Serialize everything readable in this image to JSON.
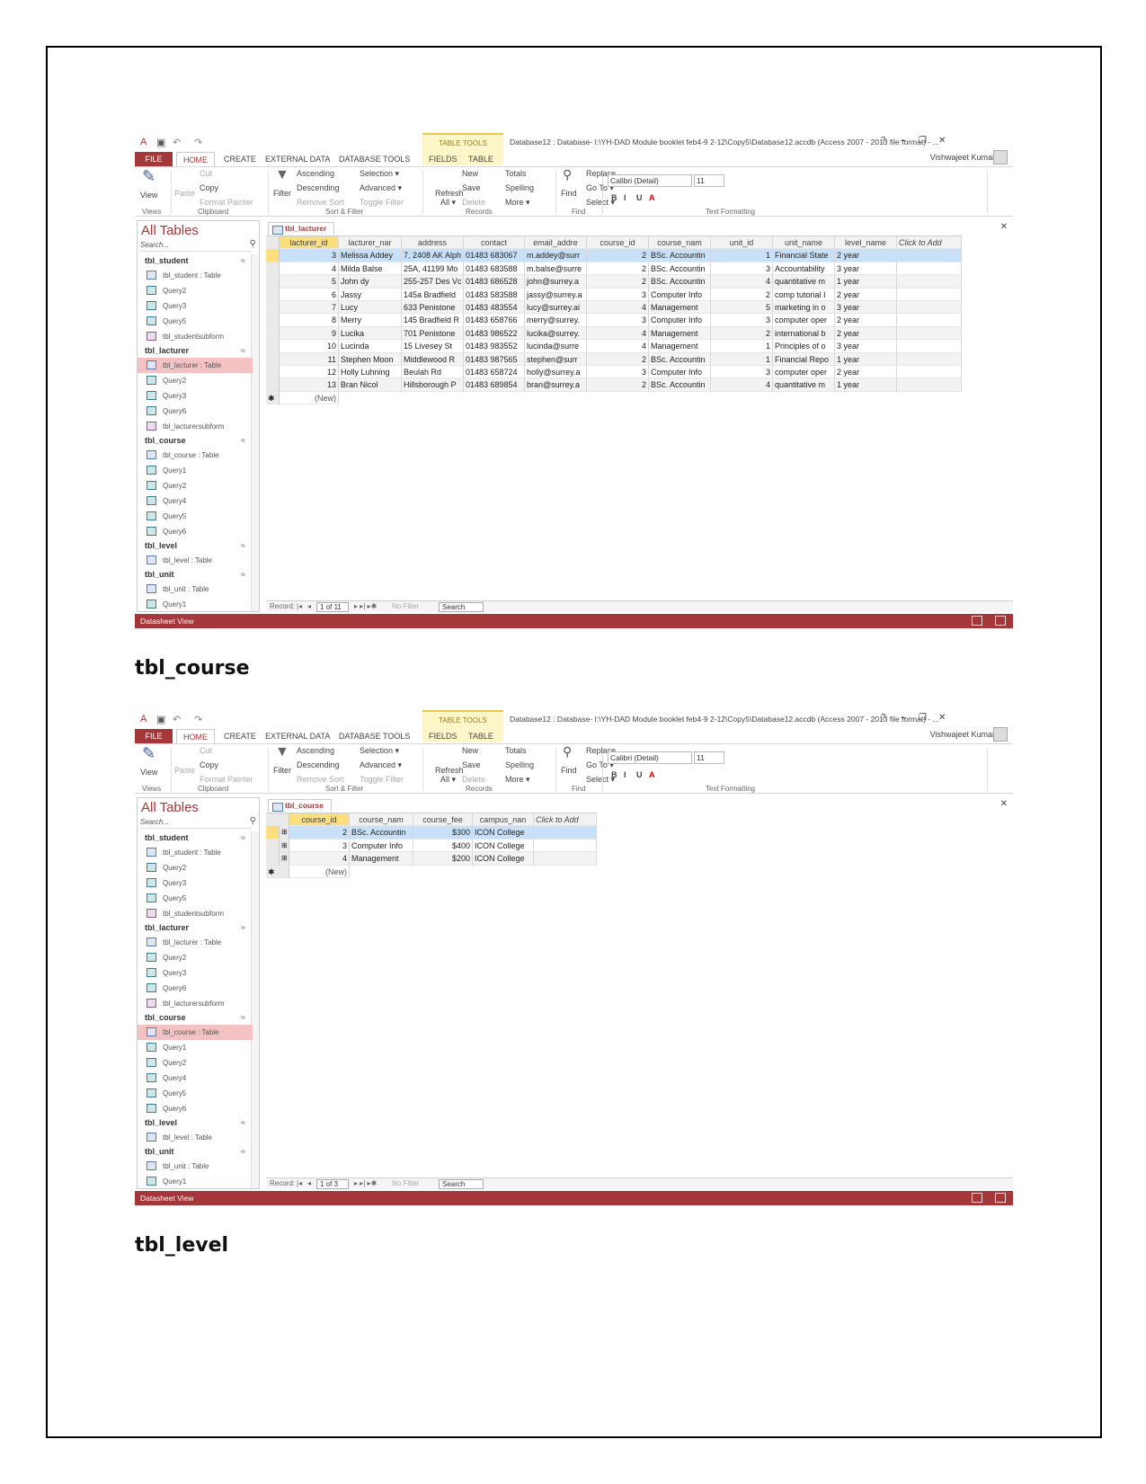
{
  "document": {
    "headings": [
      "tbl_course",
      "tbl_level"
    ]
  },
  "access": {
    "title": "Database12 : Database- I:\\YH-DAD Module booklet feb4-9 2-12\\Copy5\\Database12.accdb (Access 2007 - 2013 file format) - ...",
    "table_tools": "TABLE TOOLS",
    "tabs": [
      "FILE",
      "HOME",
      "CREATE",
      "EXTERNAL DATA",
      "DATABASE TOOLS",
      "FIELDS",
      "TABLE"
    ],
    "user": "Vishwajeet Kumar",
    "window_controls": [
      "?",
      "–",
      "❐",
      "✕"
    ],
    "ribbon": {
      "view": "View",
      "paste": "Paste",
      "cut": "Cut",
      "copy": "Copy",
      "format_painter": "Format Painter",
      "filter": "Filter",
      "ascending": "Ascending",
      "descending": "Descending",
      "remove_sort": "Remove Sort",
      "selection": "Selection ▾",
      "advanced": "Advanced ▾",
      "toggle_filter": "Toggle Filter",
      "refresh": "Refresh",
      "refresh_all": "All ▾",
      "new": "New",
      "save": "Save",
      "delete": "Delete",
      "totals": "Totals",
      "spelling": "Spelling",
      "more": "More ▾",
      "find": "Find",
      "replace": "Replace",
      "go_to": "Go To ▾",
      "select": "Select ▾",
      "font": "Calibri (Detail)",
      "font_size": "11",
      "groups": [
        "Views",
        "Clipboard",
        "Sort & Filter",
        "Records",
        "Find",
        "Text Formatting"
      ]
    },
    "nav": {
      "header": "All Tables",
      "search_placeholder": "Search...",
      "groups": [
        {
          "name": "tbl_student",
          "items": [
            [
              "tbl_student : Table",
              "t"
            ],
            [
              "Query2",
              "q"
            ],
            [
              "Query3",
              "q"
            ],
            [
              "Query5",
              "q"
            ],
            [
              "tbl_studentsubform",
              "f"
            ]
          ]
        },
        {
          "name": "tbl_lacturer",
          "items": [
            [
              "tbl_lacturer : Table",
              "t"
            ],
            [
              "Query2",
              "q"
            ],
            [
              "Query3",
              "q"
            ],
            [
              "Query6",
              "q"
            ],
            [
              "tbl_lacturersubform",
              "f"
            ]
          ]
        },
        {
          "name": "tbl_course",
          "items": [
            [
              "tbl_course : Table",
              "t"
            ],
            [
              "Query1",
              "q"
            ],
            [
              "Query2",
              "q"
            ],
            [
              "Query4",
              "q"
            ],
            [
              "Query5",
              "q"
            ],
            [
              "Query6",
              "q"
            ]
          ]
        },
        {
          "name": "tbl_level",
          "items": [
            [
              "tbl_level : Table",
              "t"
            ]
          ]
        },
        {
          "name": "tbl_unit",
          "items": [
            [
              "tbl_unit : Table",
              "t"
            ],
            [
              "Query1",
              "q"
            ]
          ]
        }
      ]
    },
    "status_text": "Datasheet View",
    "record_label": "Record:",
    "no_filter": "No Filter",
    "search": "Search",
    "new_row": "(New)",
    "colors": {
      "accent": "#a4373a",
      "selected_row": "#c8e1f9",
      "active_header": "#fbdf7f",
      "nav_selected": "#f4c2c3"
    }
  },
  "screens": [
    {
      "tab": "tbl_lacturer",
      "selected_nav": "tbl_lacturer : Table",
      "record": "1 of 11",
      "columns": [
        "lacturer_id",
        "lacturer_nar",
        "address",
        "contact",
        "email_addre",
        "course_id",
        "course_nam",
        "unit_id",
        "unit_name",
        "level_name",
        "Click to Add"
      ],
      "rows": [
        [
          "3",
          "Melissa Addey",
          "7, 2408 AK Alph",
          "01483 683067",
          "m.addey@surr",
          "2",
          "BSc. Accountin",
          "1",
          "Financial State",
          "2 year"
        ],
        [
          "4",
          "Milda Balse",
          "25A, 41199 Mo",
          "01483 683588",
          "m.balse@surre",
          "2",
          "BSc. Accountin",
          "3",
          "Accountability",
          "3 year"
        ],
        [
          "5",
          "John dy",
          "255-257 Des Vc",
          "01483 686528",
          "john@surrey.a",
          "2",
          "BSc. Accountin",
          "4",
          "quantitative m",
          "1 year"
        ],
        [
          "6",
          "Jassy",
          "145a Bradfield",
          "01483 583588",
          "jassy@surrey.a",
          "3",
          "Computer Info",
          "2",
          "comp tutorial I",
          "2 year"
        ],
        [
          "7",
          "Lucy",
          "633 Penistone",
          "01483 483554",
          "lucy@surrey.ai",
          "4",
          "Management",
          "5",
          "marketing in o",
          "3 year"
        ],
        [
          "8",
          "Merry",
          "145 Bradfield R",
          "01483 658766",
          "merry@surrey.",
          "3",
          "Computer Info",
          "3",
          "computer oper",
          "2 year"
        ],
        [
          "9",
          "Lucika",
          "701 Penistone",
          "01483 986522",
          "lucika@surrey.",
          "4",
          "Management",
          "2",
          "international b",
          "2 year"
        ],
        [
          "10",
          "Lucinda",
          "15 Livesey St",
          "01483 983552",
          "lucinda@surre",
          "4",
          "Management",
          "1",
          "Principles of o",
          "3 year"
        ],
        [
          "11",
          "Stephen Moon",
          "Middlewood R",
          "01483 987565",
          "stephen@surr",
          "2",
          "BSc. Accountin",
          "1",
          "Financial Repo",
          "1 year"
        ],
        [
          "12",
          "Holly Luhning",
          "Beulah Rd",
          "01483 658724",
          "holly@surrey.a",
          "3",
          "Computer Info",
          "3",
          "computer oper",
          "2 year"
        ],
        [
          "13",
          "Bran Nicol",
          "Hillsborough P",
          "01483 689854",
          "bran@surrey.a",
          "2",
          "BSc. Accountin",
          "4",
          "quantitative m",
          "1 year"
        ]
      ]
    },
    {
      "tab": "tbl_course",
      "selected_nav": "tbl_course : Table",
      "record": "1 of 3",
      "columns": [
        "course_id",
        "course_nam",
        "course_fee",
        "campus_nan",
        "Click to Add"
      ],
      "rows": [
        [
          "2",
          "BSc. Accountin",
          "$300",
          "ICON College"
        ],
        [
          "3",
          "Computer Info",
          "$400",
          "ICON College"
        ],
        [
          "4",
          "Management",
          "$200",
          "ICON College"
        ]
      ]
    }
  ]
}
